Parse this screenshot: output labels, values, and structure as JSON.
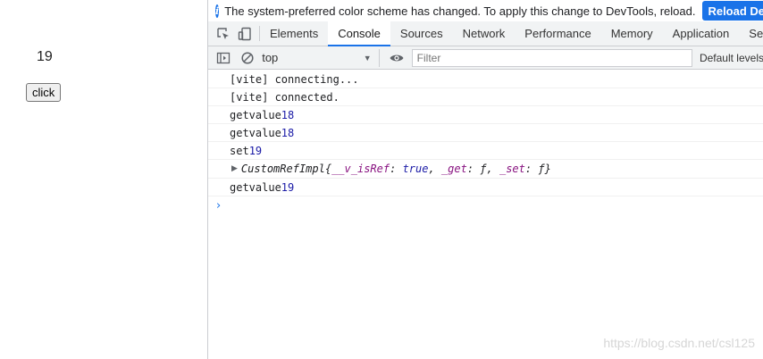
{
  "app": {
    "value": "19",
    "button_label": "click"
  },
  "infobar": {
    "message": "The system-preferred color scheme has changed. To apply this change to DevTools, reload.",
    "reload_label": "Reload DevTools"
  },
  "tabs": [
    {
      "label": "Elements"
    },
    {
      "label": "Console"
    },
    {
      "label": "Sources"
    },
    {
      "label": "Network"
    },
    {
      "label": "Performance"
    },
    {
      "label": "Memory"
    },
    {
      "label": "Application"
    },
    {
      "label": "Security"
    }
  ],
  "active_tab": "Console",
  "toolbar": {
    "context": "top",
    "filter_placeholder": "Filter",
    "levels": "Default levels"
  },
  "console_logs": [
    {
      "text": "[vite] connecting..."
    },
    {
      "text": "[vite] connected."
    },
    {
      "label": "getvalue",
      "value": "18"
    },
    {
      "label": "getvalue",
      "value": "18"
    },
    {
      "label": "set",
      "value": "19"
    },
    {
      "object": {
        "class": "CustomRefImpl",
        "open": "{",
        "k1": "__v_isRef",
        "v1": "true",
        "k2": "_get",
        "v2": "ƒ",
        "k3": "_set",
        "v3": "ƒ",
        "close": "}"
      }
    },
    {
      "label": "getvalue",
      "value": "19"
    }
  ],
  "watermark": "https://blog.csdn.net/csl125",
  "colors": {
    "accent": "#1a73e8",
    "number": "#1a1aa6",
    "key": "#881280"
  }
}
